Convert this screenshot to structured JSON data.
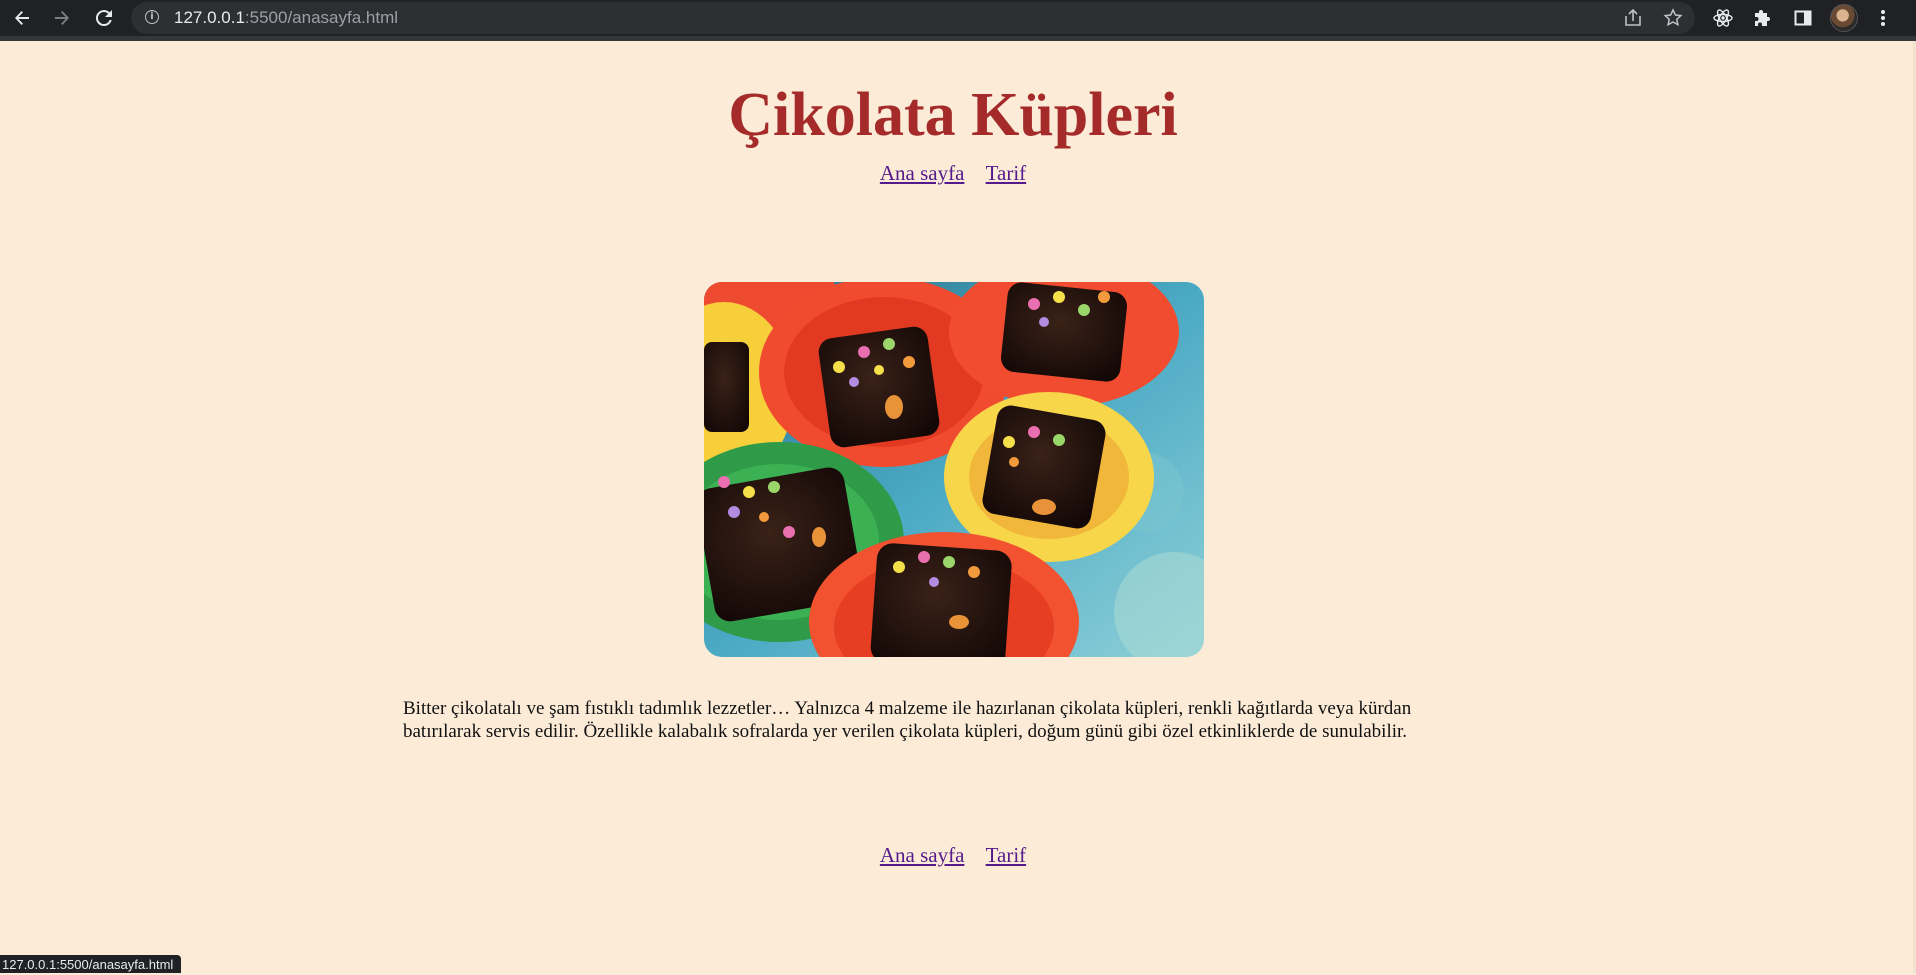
{
  "browser": {
    "url_host": "127.0.0.1",
    "url_path": ":5500/anasayfa.html",
    "status_text": "127.0.0.1:5500/anasayfa.html"
  },
  "page": {
    "title": "Çikolata Küpleri",
    "nav": {
      "home_label": "Ana sayfa",
      "recipe_label": "Tarif"
    },
    "description": "Bitter çikolatalı ve şam fıstıklı tadımlık lezzetler… Yalnızca 4 malzeme ile hazırlanan çikolata küpleri, renkli kağıtlarda veya kürdan batırılarak servis edilir. Özellikle kalabalık sofralarda yer verilen çikolata küpleri, doğum günü gibi özel etkinliklerde de sunulabilir."
  },
  "colors": {
    "background": "#fbebd7",
    "title": "#a52a2a",
    "link": "#551a8b",
    "chrome": "#202124"
  },
  "icons": [
    "back-icon",
    "forward-icon",
    "reload-icon",
    "info-icon",
    "share-icon",
    "bookmark-star-icon",
    "react-devtools-icon",
    "extensions-icon",
    "side-panel-icon",
    "profile-avatar",
    "menu-icon"
  ]
}
